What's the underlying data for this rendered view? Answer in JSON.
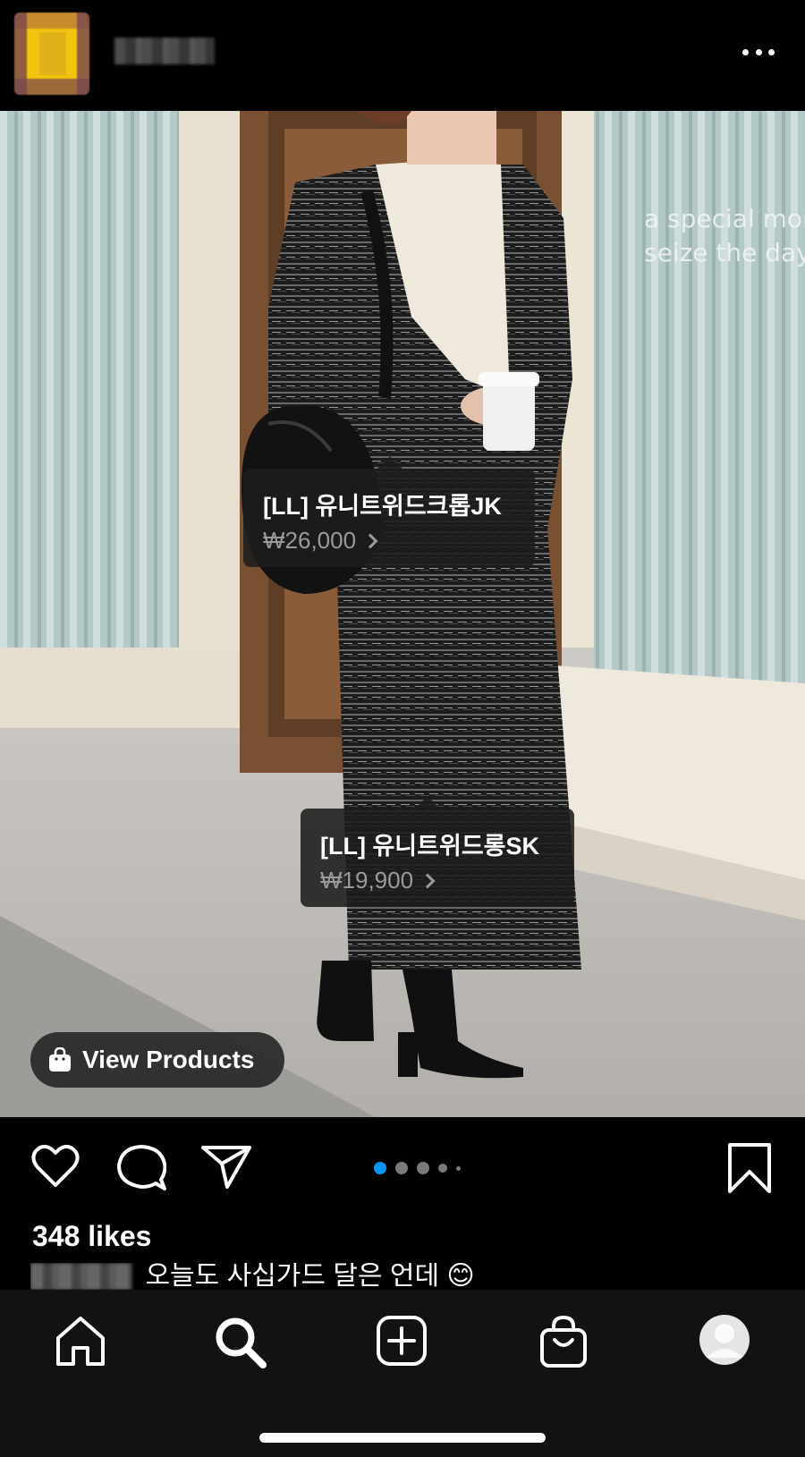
{
  "post": {
    "likes": "348 likes",
    "caption_text": "오늘도 사십가드 달은 언데 😊",
    "photo_overlay_text": [
      "a special mom",
      "seize the day"
    ]
  },
  "product_tags": [
    {
      "name": "[LL] 유니트위드크롭JK",
      "price": "₩26,000"
    },
    {
      "name": "[LL] 유니트위드롱SK",
      "price": "₩19,900"
    }
  ],
  "view_products": {
    "label": "View Products"
  },
  "carousel": {
    "count": 5,
    "active_index": 0
  },
  "colors": {
    "accent_blue": "#0095f6",
    "background": "#000000",
    "tabbar": "#121212"
  },
  "icons": [
    "more-icon",
    "heart-icon",
    "comment-icon",
    "share-icon",
    "bookmark-icon",
    "shopping-bag-icon",
    "home-icon",
    "search-icon",
    "create-post-icon",
    "shop-icon",
    "profile-avatar"
  ]
}
